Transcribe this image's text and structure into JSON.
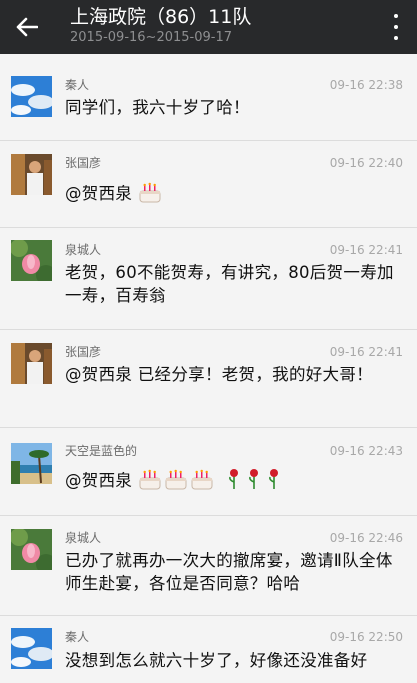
{
  "header": {
    "title": "上海政院（86）11队",
    "subtitle": "2015-09-16~2015-09-17"
  },
  "messages": [
    {
      "name": "秦人",
      "time": "09-16 22:38",
      "text": "同学们，我六十岁了哈！",
      "avatar": "sky-clouds-avatar"
    },
    {
      "name": "张国彦",
      "time": "09-16 22:40",
      "text": "@贺西泉",
      "avatar": "man-portrait-avatar"
    },
    {
      "name": "泉城人",
      "time": "09-16 22:41",
      "text": "老贺，60不能贺寿，有讲究，80后贺一寿加一寿，百寿翁",
      "avatar": "lotus-avatar"
    },
    {
      "name": "张国彦",
      "time": "09-16 22:41",
      "text": "@贺西泉 已经分享！老贺，我的好大哥！",
      "avatar": "man-portrait-avatar"
    },
    {
      "name": "天空是蓝色的",
      "time": "09-16 22:43",
      "text": "@贺西泉",
      "avatar": "beach-palm-avatar"
    },
    {
      "name": "泉城人",
      "time": "09-16 22:46",
      "text": "已办了就再办一次大的撤席宴，邀请Ⅱ队全体师生赴宴，各位是否同意？哈哈",
      "avatar": "lotus-avatar"
    },
    {
      "name": "秦人",
      "time": "09-16 22:50",
      "text": "没想到怎么就六十岁了，好像还没准备好",
      "avatar": "sky-clouds-avatar"
    }
  ]
}
